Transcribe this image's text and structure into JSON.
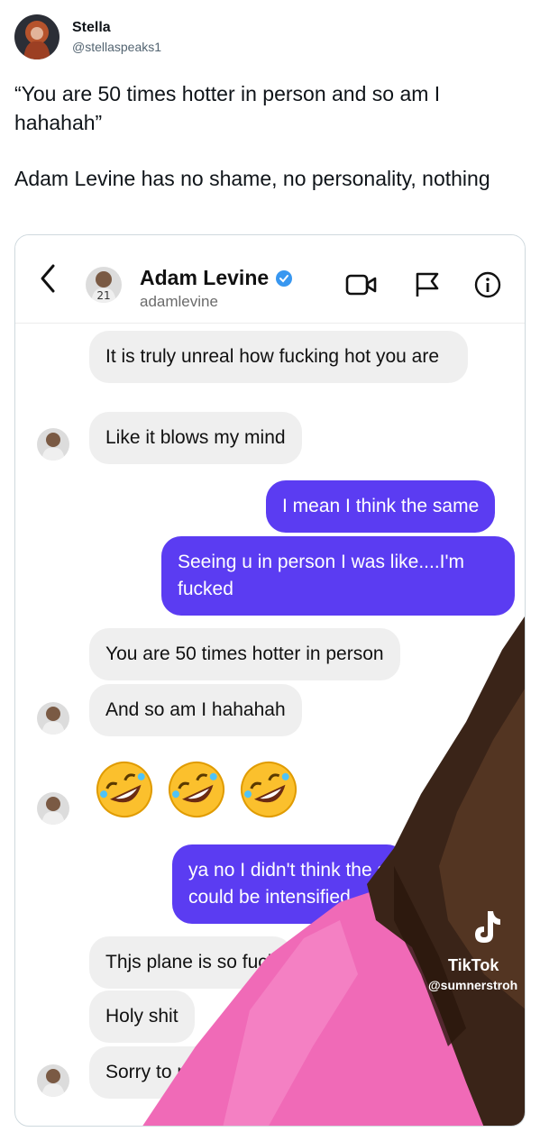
{
  "tweet": {
    "author_name": "Stella",
    "author_handle": "@stellaspeaks1",
    "text_line1": "“You are 50 times hotter in person and so am I hahahah”",
    "text_line2": "Adam Levine has no shame, no personality, nothing"
  },
  "dm": {
    "contact_name": "Adam Levine",
    "contact_username": "adamlevine",
    "messages": [
      {
        "from": "them",
        "text": "It is truly unreal how fucking hot you are"
      },
      {
        "from": "them",
        "text": "Like it blows my mind"
      },
      {
        "from": "me",
        "text": "I mean I think the same"
      },
      {
        "from": "me",
        "text": "Seeing u in person I was like....I'm fucked"
      },
      {
        "from": "them",
        "text": "You are 50 times hotter in person"
      },
      {
        "from": "them",
        "text": "And so am I hahahah"
      },
      {
        "from": "them",
        "text": "🤣🤣🤣"
      },
      {
        "from": "me",
        "text": "ya no I didn't think the s could be intensified"
      },
      {
        "from": "them",
        "text": "Thjs plane is so fuck"
      },
      {
        "from": "them",
        "text": "Holy shit"
      },
      {
        "from": "them",
        "text": "Sorry to ph"
      }
    ]
  },
  "watermark": {
    "brand": "TikTok",
    "user": "@sumnerstroh"
  },
  "colors": {
    "outgoing_bubble": "#5b3cf2",
    "incoming_bubble": "#efefef",
    "verified": "#3897f0",
    "overlay_pink": "#f06ab7",
    "overlay_hair": "#3a2418"
  }
}
